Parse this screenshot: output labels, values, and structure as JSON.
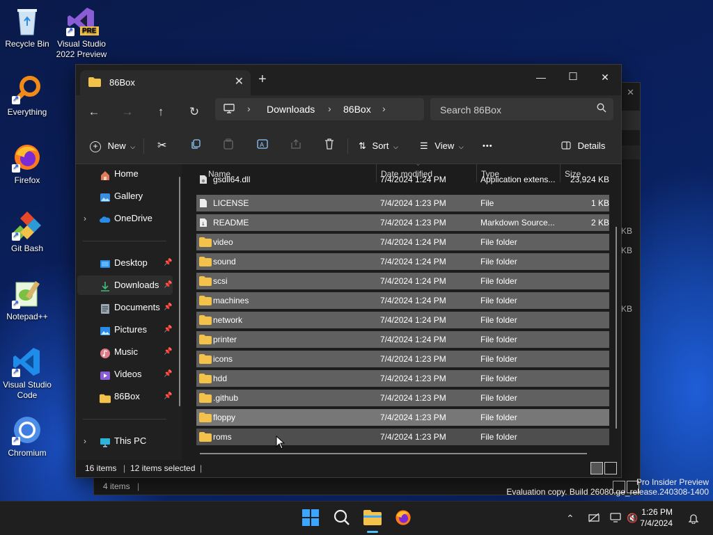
{
  "desktop": {
    "icons": [
      {
        "label": "Recycle Bin"
      },
      {
        "label": "Visual Studio 2022 Preview",
        "badge": "PRE"
      },
      {
        "label": "Everything"
      },
      {
        "label": "Firefox"
      },
      {
        "label": "Git Bash"
      },
      {
        "label": "Notepad++"
      },
      {
        "label": "Visual Studio Code"
      },
      {
        "label": "Chromium"
      }
    ],
    "watermark": {
      "line1": "Pro Insider Preview",
      "line2": "Evaluation copy. Build 26080.ge_release.240308-1400"
    }
  },
  "background_window": {
    "status_count": "4 items",
    "size_fragments": [
      "KB",
      "KB",
      "KB"
    ]
  },
  "window": {
    "tab_title": "86Box",
    "new_tab_glyph": "+",
    "controls": {
      "minimize": "—",
      "maximize": "☐",
      "close": "✕"
    },
    "breadcrumb": [
      "Downloads",
      "86Box"
    ],
    "search_placeholder": "Search 86Box",
    "toolbar": {
      "new": "New",
      "sort": "Sort",
      "view": "View",
      "more": "•••",
      "details": "Details"
    },
    "nav": {
      "home": "Home",
      "gallery": "Gallery",
      "onedrive": "OneDrive",
      "desktop": "Desktop",
      "downloads": "Downloads",
      "documents": "Documents",
      "pictures": "Pictures",
      "music": "Music",
      "videos": "Videos",
      "box86": "86Box",
      "thispc": "This PC"
    },
    "columns": {
      "name": "Name",
      "date": "Date modified",
      "type": "Type",
      "size": "Size"
    },
    "rows": [
      {
        "name": "gsdll64.dll",
        "date": "7/4/2024 1:24 PM",
        "type": "Application extens...",
        "size": "23,924 KB"
      },
      {
        "name": "LICENSE",
        "date": "7/4/2024 1:23 PM",
        "type": "File",
        "size": "1 KB"
      },
      {
        "name": "README",
        "date": "7/4/2024 1:23 PM",
        "type": "Markdown Source...",
        "size": "2 KB"
      },
      {
        "name": "video",
        "date": "7/4/2024 1:24 PM",
        "type": "File folder",
        "size": ""
      },
      {
        "name": "sound",
        "date": "7/4/2024 1:24 PM",
        "type": "File folder",
        "size": ""
      },
      {
        "name": "scsi",
        "date": "7/4/2024 1:24 PM",
        "type": "File folder",
        "size": ""
      },
      {
        "name": "machines",
        "date": "7/4/2024 1:24 PM",
        "type": "File folder",
        "size": ""
      },
      {
        "name": "network",
        "date": "7/4/2024 1:24 PM",
        "type": "File folder",
        "size": ""
      },
      {
        "name": "printer",
        "date": "7/4/2024 1:24 PM",
        "type": "File folder",
        "size": ""
      },
      {
        "name": "icons",
        "date": "7/4/2024 1:23 PM",
        "type": "File folder",
        "size": ""
      },
      {
        "name": "hdd",
        "date": "7/4/2024 1:23 PM",
        "type": "File folder",
        "size": ""
      },
      {
        "name": ".github",
        "date": "7/4/2024 1:23 PM",
        "type": "File folder",
        "size": ""
      },
      {
        "name": "floppy",
        "date": "7/4/2024 1:23 PM",
        "type": "File folder",
        "size": ""
      },
      {
        "name": "roms",
        "date": "7/4/2024 1:23 PM",
        "type": "File folder",
        "size": ""
      }
    ],
    "status": {
      "items": "16 items",
      "selected": "12 items selected"
    }
  },
  "taskbar": {
    "time": "1:26 PM",
    "date": "7/4/2024"
  },
  "colors": {
    "folder": "#f3c24b",
    "accent": "#4cc2ff",
    "selection": "#606060"
  }
}
